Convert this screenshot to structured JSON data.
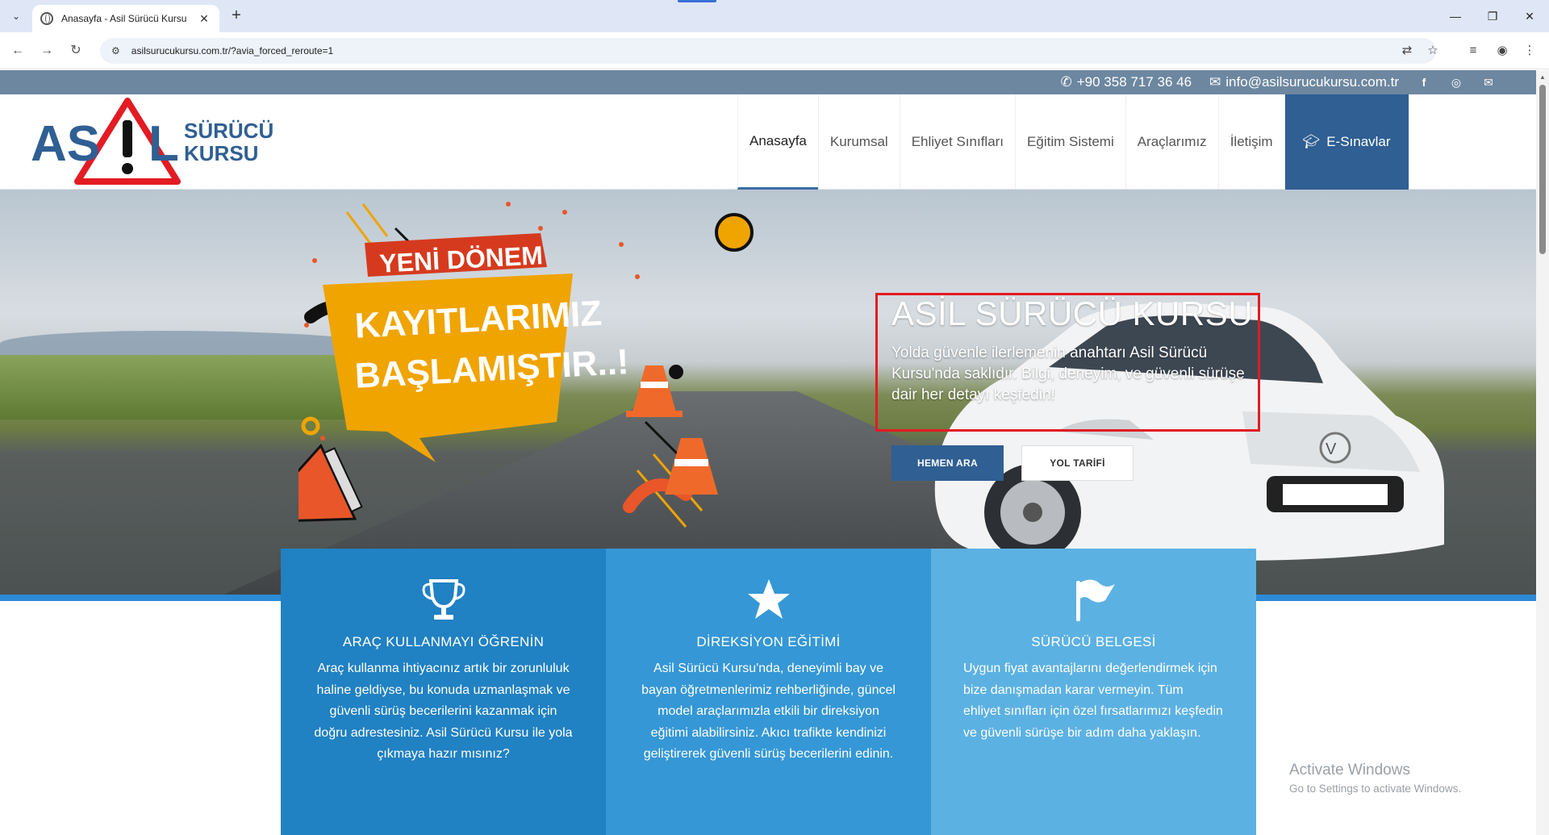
{
  "browser": {
    "tab_title": "Anasayfa - Asil Sürücü Kursu",
    "url": "asilsurucukursu.com.tr/?avia_forced_reroute=1"
  },
  "topbar": {
    "phone": "+90 358 717 36 46",
    "email": "info@asilsurucukursu.com.tr",
    "social": [
      "facebook-icon",
      "instagram-icon",
      "mail-icon"
    ]
  },
  "logo": {
    "letters_left": "AS",
    "letters_right": "L",
    "line1": "SÜRÜCÜ",
    "line2": "KURSU"
  },
  "nav": {
    "items": [
      "Anasayfa",
      "Kurumsal",
      "Ehliyet Sınıfları",
      "Eğitim Sistemi",
      "Araçlarımız",
      "İletişim"
    ],
    "cta": "E-Sınavlar"
  },
  "hero": {
    "promo_top": "YENİ DÖNEM",
    "promo_line1": "KAYITLARIMIZ",
    "promo_line2": "BAŞLAMIŞTIR..!",
    "title": "ASİL SÜRÜCÜ KURSU",
    "text": "Yolda güvenle ilerlemenin anahtarı Asil Sürücü Kursu'nda saklıdır. Bilgi, deneyim, ve güvenli sürüşe dair her detayı keşfedin!",
    "btn_primary": "HEMEN ARA",
    "btn_secondary": "YOL TARİFİ"
  },
  "features": [
    {
      "title": "ARAÇ KULLANMAYI ÖĞRENİN",
      "text": "Araç kullanma ihtiyacınız artık bir zorunluluk haline geldiyse, bu konuda uzmanlaşmak ve güvenli sürüş becerilerini kazanmak için doğru adrestesiniz. Asil Sürücü Kursu ile yola çıkmaya hazır mısınız?",
      "icon": "trophy-icon"
    },
    {
      "title": "DİREKSİYON EĞİTİMİ",
      "text": "Asil Sürücü Kursu'nda, deneyimli bay ve bayan öğretmenlerimiz rehberliğinde, güncel model araçlarımızla etkili bir direksiyon eğitimi alabilirsiniz. Akıcı trafikte kendinizi geliştirerek güvenli sürüş becerilerini edinin.",
      "icon": "star-icon"
    },
    {
      "title": "SÜRÜCÜ BELGESİ",
      "text": "Uygun fiyat avantajlarını değerlendirmek için bize danışmadan karar vermeyin. Tüm ehliyet sınıfları için özel fırsatlarımızı keşfedin ve güvenli sürüşe bir adım daha yaklaşın.",
      "icon": "flag-icon"
    }
  ],
  "watermark": {
    "line1": "Activate Windows",
    "line2": "Go to Settings to activate Windows."
  },
  "colors": {
    "primary": "#2f5f93",
    "topbar": "#6d87a0",
    "feature1": "#2081c3",
    "feature2": "#3597d6",
    "feature3": "#5cb1e3",
    "highlight": "#e31b23"
  }
}
